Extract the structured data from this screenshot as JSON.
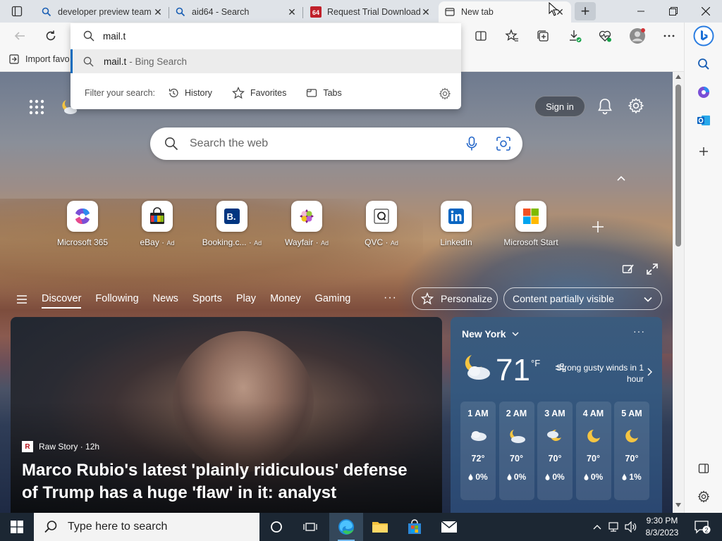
{
  "tabs": [
    {
      "title": "developer preview team",
      "icon": "search-icon"
    },
    {
      "title": "aid64 - Search",
      "icon": "search-icon"
    },
    {
      "title": "Request Trial Download",
      "icon": "aida64-icon"
    },
    {
      "title": "New tab",
      "icon": "newtab-icon"
    }
  ],
  "omnibox": {
    "value": "mail.t",
    "suggestion_main": "mail.t",
    "suggestion_sub": " - Bing Search",
    "filter_label": "Filter your search:",
    "filters": [
      "History",
      "Favorites",
      "Tabs"
    ]
  },
  "favbar": {
    "import_label": "Import favo"
  },
  "page": {
    "signin": "Sign in",
    "search_placeholder": "Search the web"
  },
  "quicklinks": [
    {
      "name": "Microsoft 365",
      "ad": ""
    },
    {
      "name": "eBay",
      "ad": "Ad"
    },
    {
      "name": "Booking.c...",
      "ad": "Ad"
    },
    {
      "name": "Wayfair",
      "ad": "Ad"
    },
    {
      "name": "QVC",
      "ad": "Ad"
    },
    {
      "name": "LinkedIn",
      "ad": ""
    },
    {
      "name": "Microsoft Start",
      "ad": ""
    }
  ],
  "feednav": {
    "items": [
      "Discover",
      "Following",
      "News",
      "Sports",
      "Play",
      "Money",
      "Gaming"
    ],
    "more": "···",
    "personalize": "Personalize",
    "content_visibility": "Content partially visible"
  },
  "hero": {
    "source": "Raw Story",
    "source_logo": "R",
    "age": "12h",
    "title": "Marco Rubio's latest 'plainly ridiculous' defense of Trump has a huge 'flaw' in it: analyst"
  },
  "weather": {
    "city": "New York",
    "temp": "71",
    "unit": "°F",
    "alert": "Strong gusty winds in 1 hour",
    "hours": [
      {
        "time": "1 AM",
        "temp": "72°",
        "precip": "0%",
        "icon": "cloudy-night-icon"
      },
      {
        "time": "2 AM",
        "temp": "70°",
        "precip": "0%",
        "icon": "partly-cloudy-night-icon"
      },
      {
        "time": "3 AM",
        "temp": "70°",
        "precip": "0%",
        "icon": "partly-cloudy-night-icon"
      },
      {
        "time": "4 AM",
        "temp": "70°",
        "precip": "0%",
        "icon": "moon-icon"
      },
      {
        "time": "5 AM",
        "temp": "70°",
        "precip": "1%",
        "icon": "moon-icon"
      }
    ]
  },
  "taskbar": {
    "search_placeholder": "Type here to search",
    "time": "9:30 PM",
    "date": "8/3/2023",
    "notifications": "2"
  },
  "colors": {
    "accent": "#0f6cbd",
    "taskbar": "#1c2733"
  }
}
